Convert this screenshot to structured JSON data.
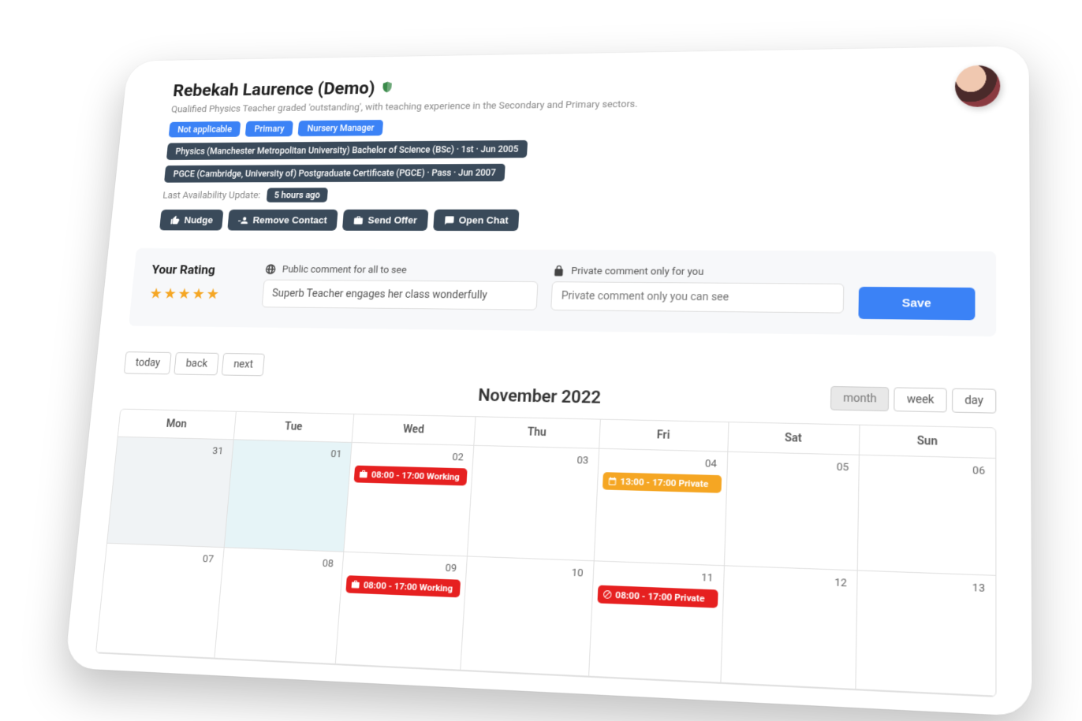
{
  "profile": {
    "name": "Rebekah Laurence (Demo)",
    "subtitle": "Qualified Physics Teacher graded 'outstanding', with teaching experience in the Secondary and Primary sectors.",
    "tags": [
      "Not applicable",
      "Primary",
      "Nursery Manager"
    ],
    "qualifications": [
      "Physics (Manchester Metropolitan University) Bachelor of Science (BSc) · 1st · Jun 2005",
      "PGCE (Cambridge, University of) Postgraduate Certificate (PGCE) · Pass · Jun 2007"
    ],
    "availability_label": "Last Availability Update:",
    "availability_ago": "5 hours ago"
  },
  "actions": {
    "nudge": "Nudge",
    "remove": "Remove Contact",
    "offer": "Send Offer",
    "chat": "Open Chat"
  },
  "rating": {
    "heading": "Your Rating",
    "stars_display": "★★★★★",
    "public_label": "Public comment for all to see",
    "public_value": "Superb Teacher engages her class wonderfully",
    "private_label": "Private comment only for you",
    "private_placeholder": "Private comment only you can see",
    "save": "Save"
  },
  "calendar": {
    "title": "November 2022",
    "nav": {
      "today": "today",
      "back": "back",
      "next": "next"
    },
    "views": {
      "month": "month",
      "week": "week",
      "day": "day"
    },
    "weekdays": [
      "Mon",
      "Tue",
      "Wed",
      "Thu",
      "Fri",
      "Sat",
      "Sun"
    ],
    "rows": [
      {
        "cells": [
          {
            "date": "31",
            "off": true
          },
          {
            "date": "01",
            "today": true
          },
          {
            "date": "02",
            "event": {
              "text": "08:00 - 17:00 Working",
              "color": "red",
              "icon": "briefcase"
            }
          },
          {
            "date": "03"
          },
          {
            "date": "04",
            "event": {
              "text": "13:00 - 17:00 Private",
              "color": "amber",
              "icon": "calendar"
            }
          },
          {
            "date": "05"
          },
          {
            "date": "06"
          }
        ]
      },
      {
        "cells": [
          {
            "date": "07"
          },
          {
            "date": "08"
          },
          {
            "date": "09",
            "event": {
              "text": "08:00 - 17:00 Working",
              "color": "red",
              "icon": "briefcase"
            }
          },
          {
            "date": "10"
          },
          {
            "date": "11",
            "event": {
              "text": "08:00 - 17:00 Private",
              "color": "red",
              "icon": "block"
            }
          },
          {
            "date": "12"
          },
          {
            "date": "13"
          }
        ]
      }
    ]
  }
}
